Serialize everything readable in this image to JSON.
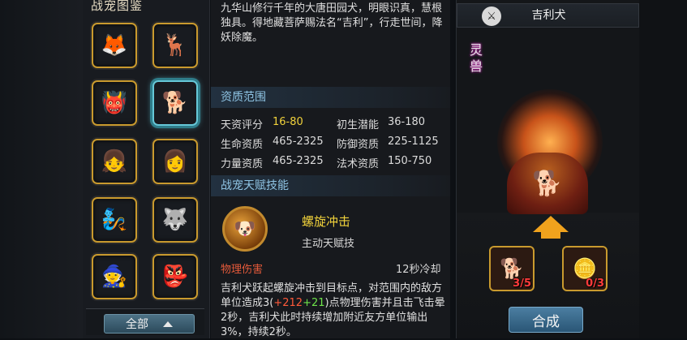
{
  "gallery": {
    "title": "战宠图鉴",
    "filter_label": "全部",
    "slots": [
      {
        "icon": "red-warrior-portrait",
        "glyph": "🦊"
      },
      {
        "icon": "white-deer-portrait",
        "glyph": "🦌"
      },
      {
        "icon": "green-monster-portrait",
        "glyph": "👹"
      },
      {
        "icon": "dog-warrior-portrait",
        "glyph": "🐕"
      },
      {
        "icon": "white-hair-girl-portrait",
        "glyph": "👧"
      },
      {
        "icon": "red-armor-girl-portrait",
        "glyph": "👩"
      },
      {
        "icon": "blue-spirit-portrait",
        "glyph": "🧞"
      },
      {
        "icon": "armored-beast-portrait",
        "glyph": "🐺"
      },
      {
        "icon": "purple-mage-portrait",
        "glyph": "🧙"
      },
      {
        "icon": "red-demon-portrait",
        "glyph": "👺"
      }
    ]
  },
  "info": {
    "description": "九华山修行千年的大唐田园犬，明眼识真，慧根独具。得地藏菩萨赐法名“吉利”，行走世间，降妖除魔。",
    "aptitude_title": "资质范围",
    "stats": [
      {
        "label": "天资评分",
        "value": "16-80"
      },
      {
        "label": "初生潜能",
        "value": "36-180"
      },
      {
        "label": "生命资质",
        "value": "465-2325"
      },
      {
        "label": "防御资质",
        "value": "225-1125"
      },
      {
        "label": "力量资质",
        "value": "465-2325"
      },
      {
        "label": "法术资质",
        "value": "150-750"
      }
    ],
    "talent_title": "战宠天赋技能",
    "skill": {
      "name": "螺旋冲击",
      "type": "主动天赋技",
      "damage_type": "物理伤害",
      "cooldown": "12秒冷却",
      "desc_prefix": "吉利犬跃起螺旋冲击到目标点，对范围内的敌方单位造成3(",
      "bonus_red": "+212",
      "bonus_green": "+21",
      "desc_suffix": ")点物理伤害并且击飞击晕2秒，吉利犬此时持续增加附近友方单位输出3%，持续2秒。"
    }
  },
  "preview": {
    "pet_name": "吉利犬",
    "rank_text": "灵兽",
    "materials": [
      {
        "icon": "dog-shard-icon",
        "count": "3/5"
      },
      {
        "icon": "gold-coin-icon",
        "count": "0/3"
      }
    ],
    "compose_label": "合成"
  },
  "colors": {
    "highlight_yellow": "#f1d23b",
    "damage_red": "#e65a3a",
    "section_blue": "#8fc4e4",
    "frame_gold": "#c99a2e",
    "selected_cyan": "#66c8d8"
  }
}
